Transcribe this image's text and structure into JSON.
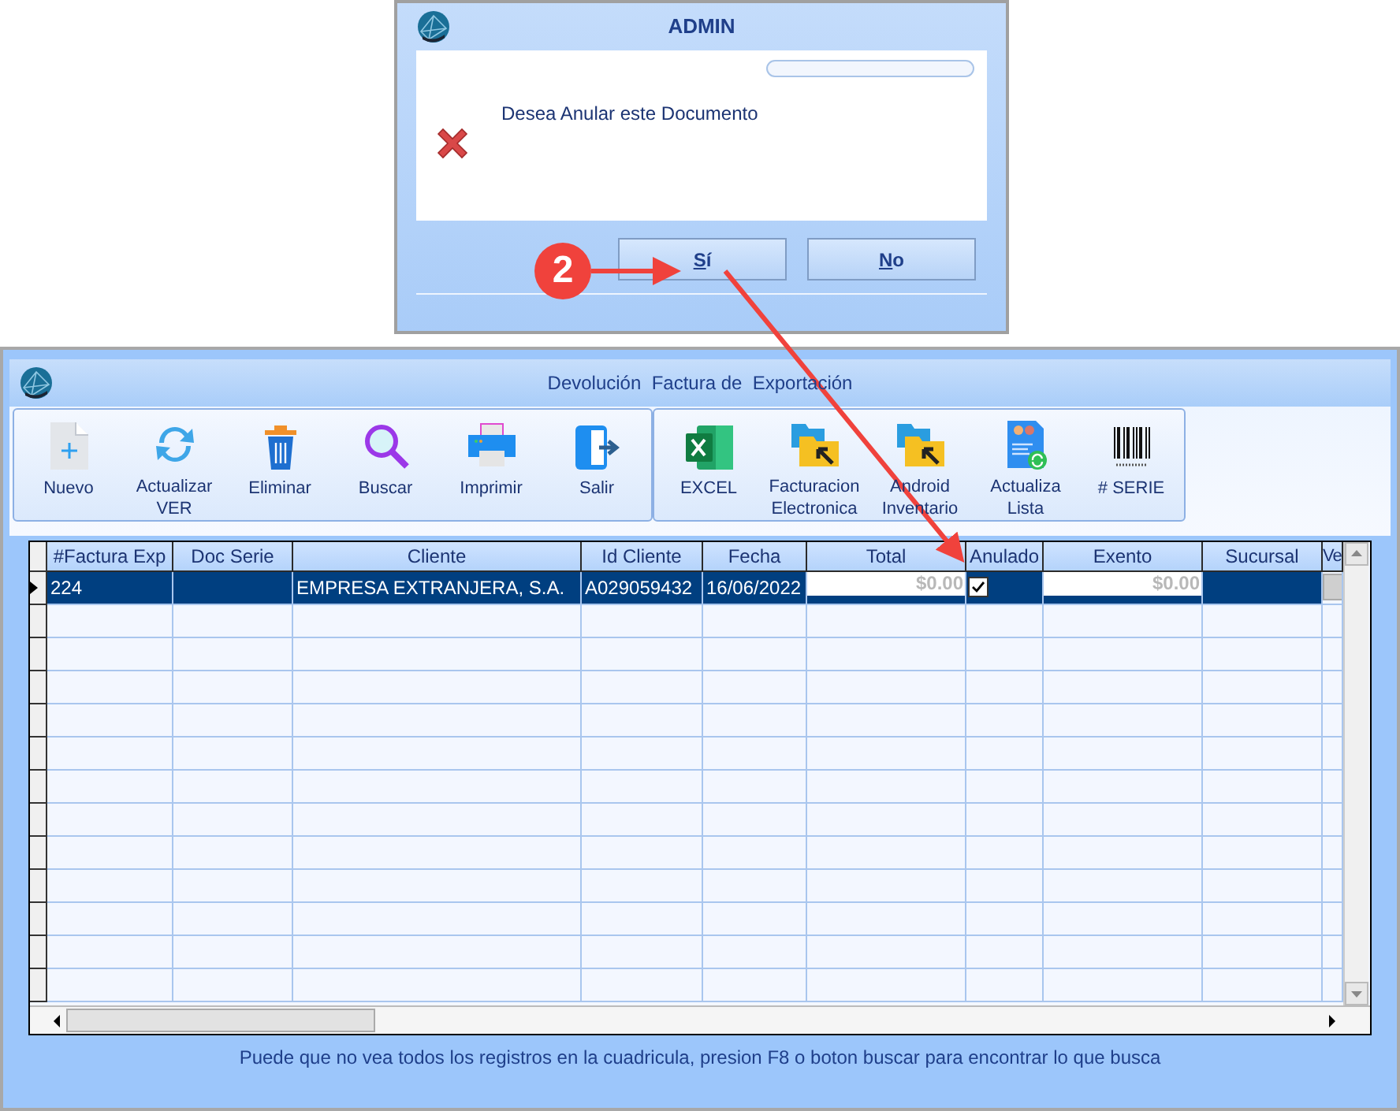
{
  "dialog": {
    "title": "ADMIN",
    "progress": {
      "level": 0
    },
    "message": "Desea Anular este Documento",
    "buttons": [
      {
        "label": "Sí"
      },
      {
        "label": "No"
      }
    ]
  },
  "annotation": {
    "step": "2"
  },
  "window": {
    "title": "Devolución  Factura de  Exportación"
  },
  "toolbar": {
    "groups": [
      [
        {
          "label": "Nuevo"
        },
        {
          "label": "Actualizar VER"
        },
        {
          "label": "Eliminar"
        },
        {
          "label": "Buscar"
        },
        {
          "label": "Imprimir"
        },
        {
          "label": "Salir"
        }
      ],
      [
        {
          "label": "EXCEL"
        },
        {
          "label": "Facturacion Electronica"
        },
        {
          "label": "Android Inventario"
        },
        {
          "label": "Actualiza Lista"
        },
        {
          "label": "# SERIE"
        }
      ]
    ]
  },
  "table": {
    "columns": [
      "#Factura Exp",
      "Doc Serie",
      "Cliente",
      "Id Cliente",
      "Fecha",
      "Total",
      "Anulado",
      "Exento",
      "Sucursal",
      "Ve"
    ],
    "rows": [
      {
        "selected": true,
        "factura": "224",
        "cliente": "EMPRESA EXTRANJERA, S.A.",
        "id_cliente": "A029059432",
        "fecha": "16/06/2022",
        "total": "$0.00",
        "anulado": true,
        "exento": "$0.00"
      }
    ]
  },
  "status_bar": "Puede que no vea todos los registros en la cuadricula, presion F8 o boton buscar para encontrar lo que busca"
}
